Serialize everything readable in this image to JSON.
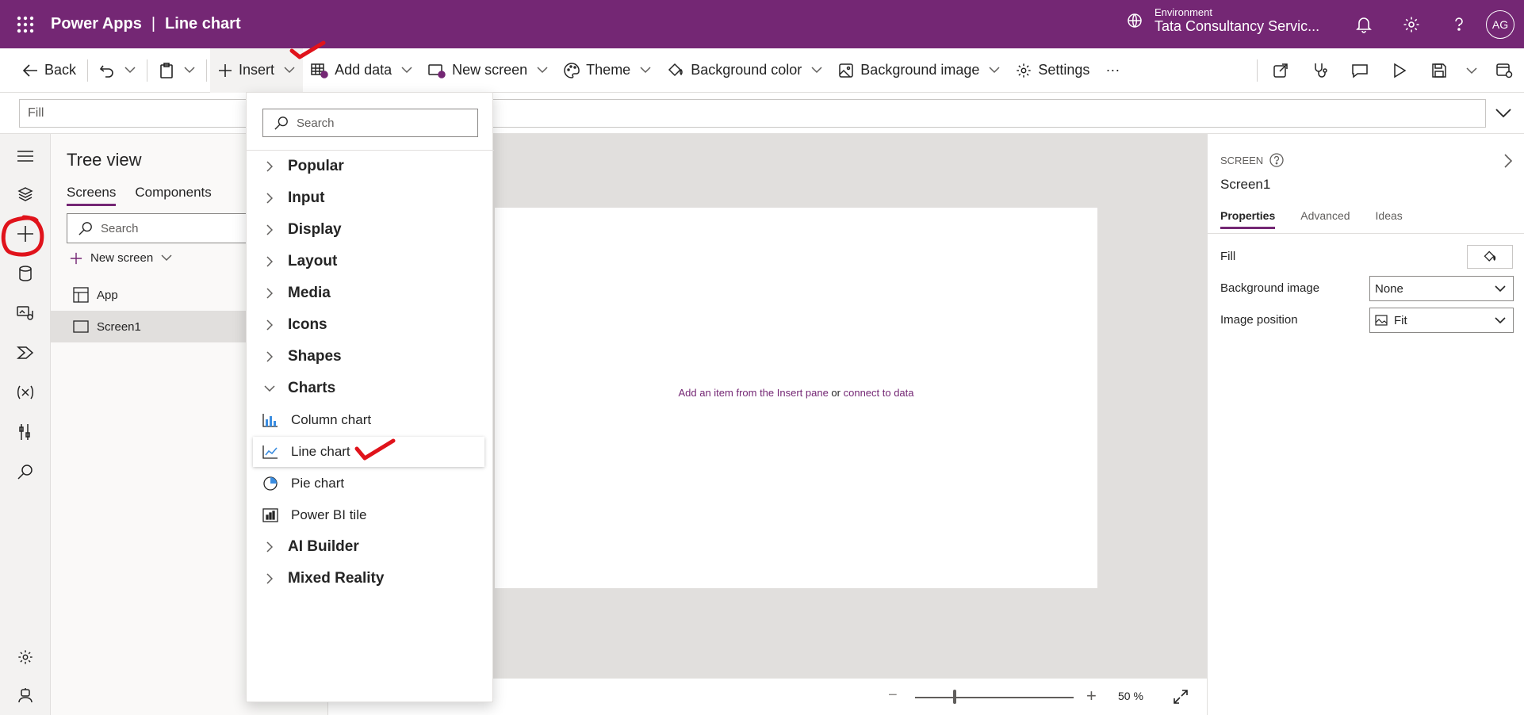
{
  "header": {
    "product": "Power Apps",
    "separator": "|",
    "app_name": "Line chart",
    "environment_label": "Environment",
    "environment_name": "Tata Consultancy Servic...",
    "avatar_initials": "AG"
  },
  "commands": {
    "back": "Back",
    "insert": "Insert",
    "add_data": "Add data",
    "new_screen": "New screen",
    "theme": "Theme",
    "background_color": "Background color",
    "background_image": "Background image",
    "settings": "Settings",
    "more": "···"
  },
  "formula_bar": {
    "property": "Fill"
  },
  "tree_view": {
    "title": "Tree view",
    "tabs": [
      "Screens",
      "Components"
    ],
    "search_placeholder": "Search",
    "new_screen": "New screen",
    "items": [
      "App",
      "Screen1"
    ]
  },
  "canvas": {
    "hint_prefix": "Add an item from the Insert pane",
    "hint_or": "or",
    "hint_link": "connect to data",
    "zoom_value": "50",
    "zoom_unit": "%"
  },
  "properties": {
    "kind": "SCREEN",
    "name": "Screen1",
    "tabs": [
      "Properties",
      "Advanced",
      "Ideas"
    ],
    "fill_label": "Fill",
    "bg_image_label": "Background image",
    "bg_image_value": "None",
    "image_position_label": "Image position",
    "image_position_value": "Fit"
  },
  "insert_pane": {
    "search_placeholder": "Search",
    "categories": [
      "Popular",
      "Input",
      "Display",
      "Layout",
      "Media",
      "Icons",
      "Shapes",
      "Charts"
    ],
    "chart_items": [
      "Column chart",
      "Line chart",
      "Pie chart",
      "Power BI tile"
    ],
    "more_categories": [
      "AI Builder",
      "Mixed Reality"
    ]
  },
  "colors": {
    "brand": "#742774",
    "annotation": "#e0131b"
  }
}
